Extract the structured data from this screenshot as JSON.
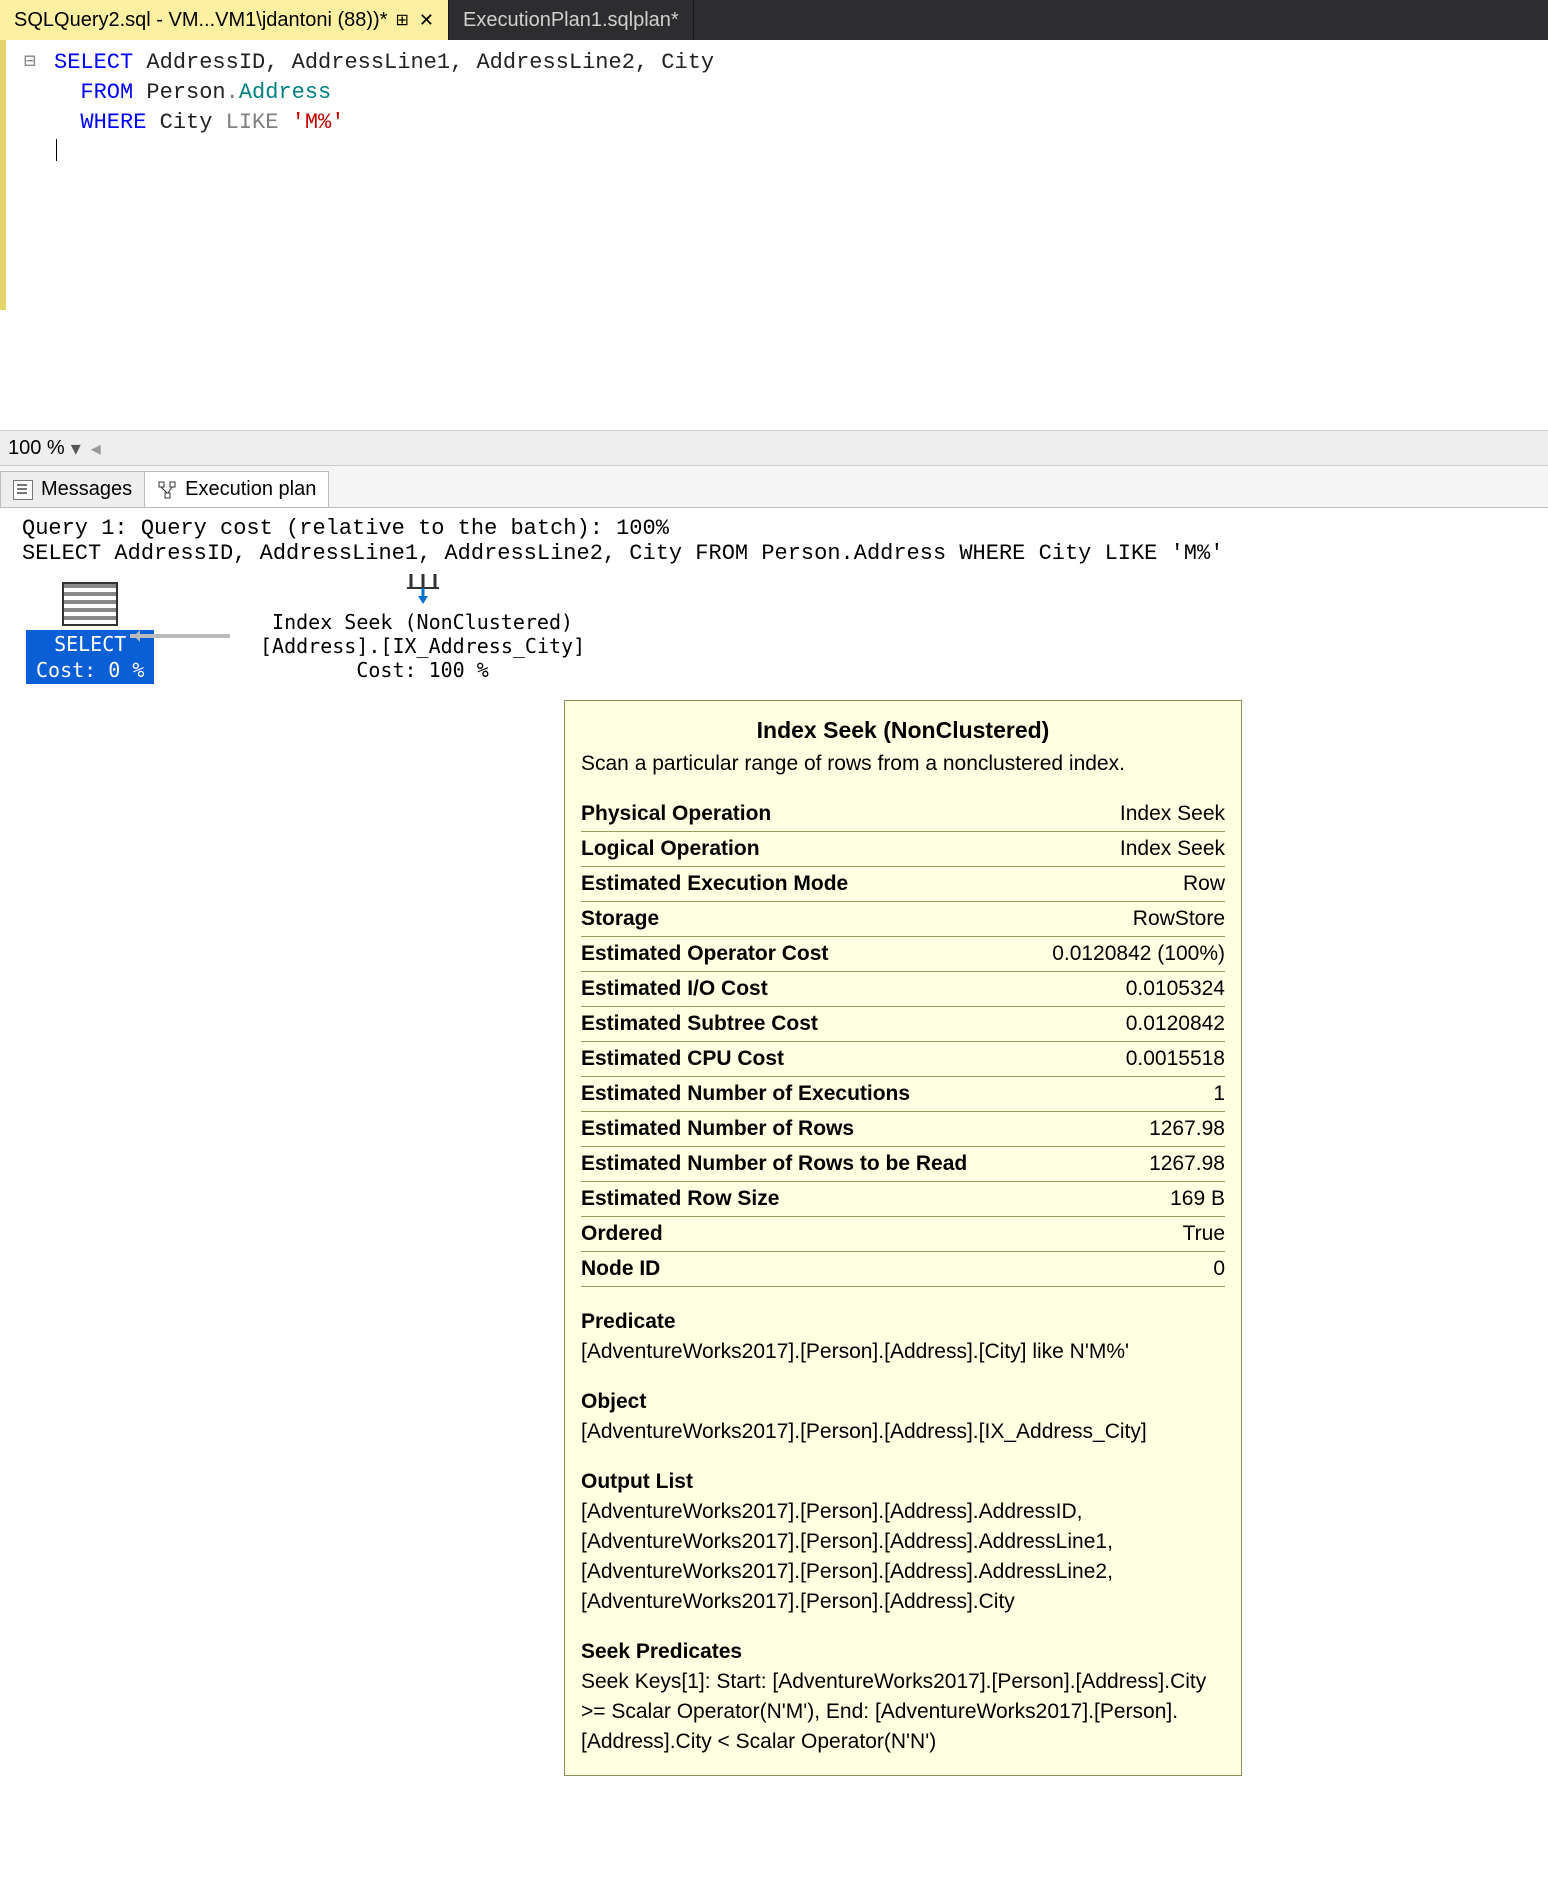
{
  "tabs": {
    "active": "SQLQuery2.sql - VM...VM1\\jdantoni (88))*",
    "inactive": "ExecutionPlan1.sqlplan*"
  },
  "sql": {
    "line1_select": "SELECT",
    "line1_cols": " AddressID, AddressLine1, AddressLine2, City",
    "line2_from": "FROM",
    "line2_obj1": " Person",
    "line2_dot": ".",
    "line2_obj2": "Address",
    "line3_where": "WHERE",
    "line3_col": " City ",
    "line3_like": "LIKE",
    "line3_str": " 'M%'"
  },
  "zoom": "100 %",
  "result_tabs": {
    "messages": "Messages",
    "plan": "Execution plan"
  },
  "plan_header": {
    "line1": "Query 1: Query cost (relative to the batch): 100%",
    "line2": "SELECT AddressID, AddressLine1, AddressLine2, City FROM Person.Address WHERE City LIKE 'M%'"
  },
  "plan_nodes": {
    "select_label": "SELECT",
    "select_cost": "Cost: 0 %",
    "seek_line1": "Index Seek (NonClustered)",
    "seek_line2": "[Address].[IX_Address_City]",
    "seek_line3": "Cost: 100 %"
  },
  "tooltip": {
    "title": "Index Seek (NonClustered)",
    "desc": "Scan a particular range of rows from a nonclustered index.",
    "rows": [
      {
        "k": "Physical Operation",
        "v": "Index Seek"
      },
      {
        "k": "Logical Operation",
        "v": "Index Seek"
      },
      {
        "k": "Estimated Execution Mode",
        "v": "Row"
      },
      {
        "k": "Storage",
        "v": "RowStore"
      },
      {
        "k": "Estimated Operator Cost",
        "v": "0.0120842 (100%)"
      },
      {
        "k": "Estimated I/O Cost",
        "v": "0.0105324"
      },
      {
        "k": "Estimated Subtree Cost",
        "v": "0.0120842"
      },
      {
        "k": "Estimated CPU Cost",
        "v": "0.0015518"
      },
      {
        "k": "Estimated Number of Executions",
        "v": "1"
      },
      {
        "k": "Estimated Number of Rows",
        "v": "1267.98"
      },
      {
        "k": "Estimated Number of Rows to be Read",
        "v": "1267.98"
      },
      {
        "k": "Estimated Row Size",
        "v": "169 B"
      },
      {
        "k": "Ordered",
        "v": "True"
      },
      {
        "k": "Node ID",
        "v": "0"
      }
    ],
    "sections": [
      {
        "hdr": "Predicate",
        "body": "[AdventureWorks2017].[Person].[Address].[City] like N'M%'"
      },
      {
        "hdr": "Object",
        "body": "[AdventureWorks2017].[Person].[Address].[IX_Address_City]"
      },
      {
        "hdr": "Output List",
        "body": "[AdventureWorks2017].[Person].[Address].AddressID, [AdventureWorks2017].[Person].[Address].AddressLine1, [AdventureWorks2017].[Person].[Address].AddressLine2, [AdventureWorks2017].[Person].[Address].City"
      },
      {
        "hdr": "Seek Predicates",
        "body": "Seek Keys[1]: Start: [AdventureWorks2017].[Person].[Address].City >= Scalar Operator(N'M'), End: [AdventureWorks2017].[Person].[Address].City < Scalar Operator(N'N')"
      }
    ]
  }
}
